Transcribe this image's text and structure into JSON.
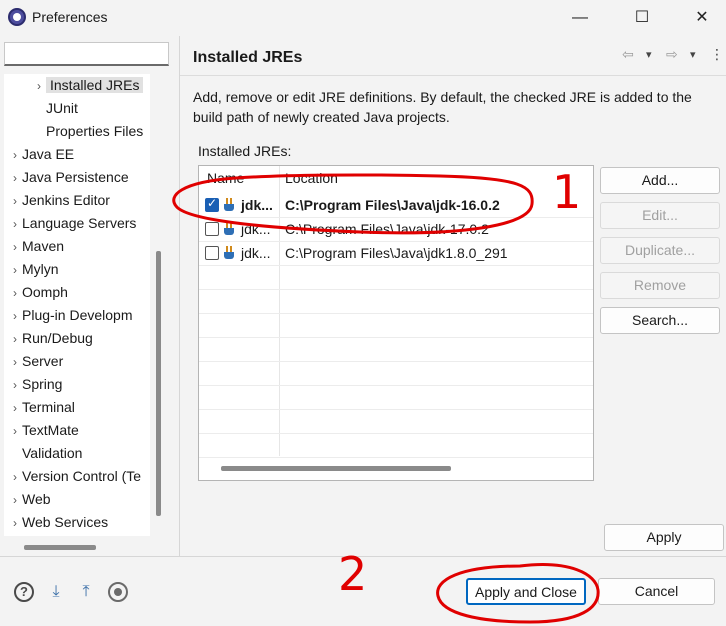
{
  "window": {
    "title": "Preferences",
    "minimize": "—",
    "maximize": "☐",
    "close": "✕"
  },
  "sidebar": {
    "filter_value": "",
    "items": [
      {
        "label": "Installed JREs",
        "chevron": "›",
        "selected": true
      },
      {
        "label": "JUnit",
        "chevron": ""
      },
      {
        "label": "Properties Files",
        "chevron": ""
      },
      {
        "label": "Java EE",
        "chevron": "›"
      },
      {
        "label": "Java Persistence",
        "chevron": "›"
      },
      {
        "label": "Jenkins Editor",
        "chevron": "›"
      },
      {
        "label": "Language Servers",
        "chevron": "›"
      },
      {
        "label": "Maven",
        "chevron": "›"
      },
      {
        "label": "Mylyn",
        "chevron": "›"
      },
      {
        "label": "Oomph",
        "chevron": "›"
      },
      {
        "label": "Plug-in Developm",
        "chevron": "›"
      },
      {
        "label": "Run/Debug",
        "chevron": "›"
      },
      {
        "label": "Server",
        "chevron": "›"
      },
      {
        "label": "Spring",
        "chevron": "›"
      },
      {
        "label": "Terminal",
        "chevron": "›"
      },
      {
        "label": "TextMate",
        "chevron": "›"
      },
      {
        "label": "Validation",
        "chevron": ""
      },
      {
        "label": "Version Control (Te",
        "chevron": "›"
      },
      {
        "label": "Web",
        "chevron": "›"
      },
      {
        "label": "Web Services",
        "chevron": "›"
      }
    ]
  },
  "page": {
    "title": "Installed JREs",
    "nav_back": "⇦",
    "nav_back_menu": "▾",
    "nav_forward": "⇨",
    "nav_forward_menu": "▾",
    "menu": "⋮",
    "description": "Add, remove or edit JRE definitions. By default, the checked JRE is added to the build path of newly created Java projects.",
    "jres_label": "Installed JREs:"
  },
  "table": {
    "headers": {
      "name": "Name",
      "location": "Location"
    },
    "rows": [
      {
        "checked": true,
        "name": "jdk...",
        "location": "C:\\Program Files\\Java\\jdk-16.0.2",
        "default": true
      },
      {
        "checked": false,
        "name": "jdk...",
        "location": "C:\\Program Files\\Java\\jdk-17.0.2",
        "default": false
      },
      {
        "checked": false,
        "name": "jdk...",
        "location": "C:\\Program Files\\Java\\jdk1.8.0_291",
        "default": false
      }
    ]
  },
  "buttons": {
    "add": "Add...",
    "edit": "Edit...",
    "duplicate": "Duplicate...",
    "remove": "Remove",
    "search": "Search...",
    "apply": "Apply",
    "apply_and_close": "Apply and Close",
    "cancel": "Cancel"
  },
  "bottom_icons": {
    "help": "?",
    "import": "⤓",
    "export": "⤒"
  },
  "annotations": {
    "marker_1": "1",
    "marker_2": "2"
  },
  "colors": {
    "accent": "#0067c0",
    "checked": "#1a5fb4",
    "annotation": "#e00000"
  }
}
